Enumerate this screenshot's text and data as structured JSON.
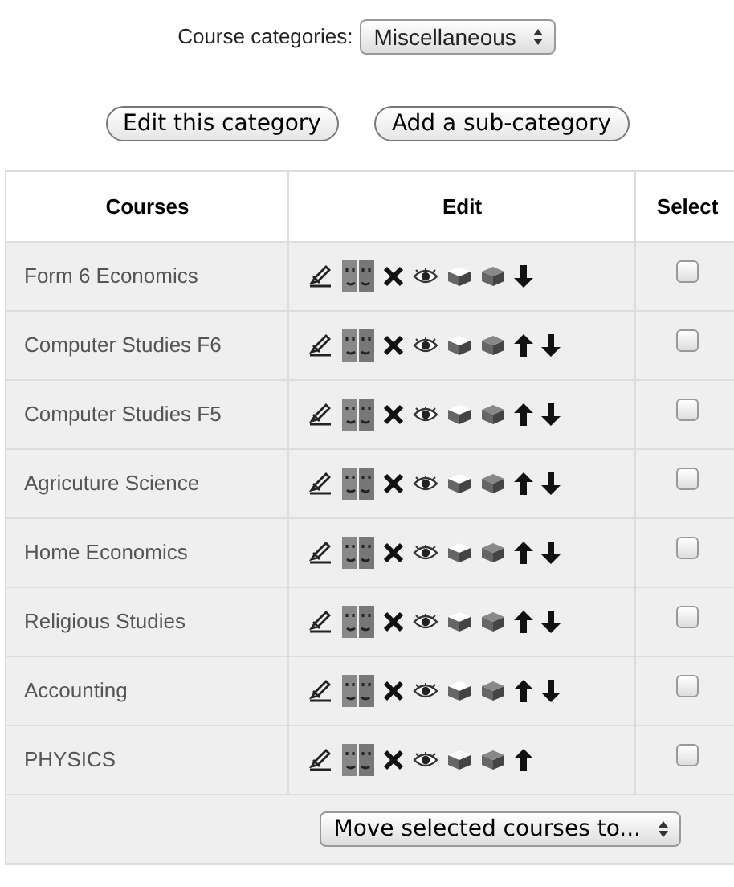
{
  "category_selector": {
    "label": "Course categories:",
    "value": "Miscellaneous"
  },
  "buttons": [
    "Edit this category",
    "Add a sub-category"
  ],
  "table": {
    "columns": [
      "Courses",
      "Edit",
      "Select"
    ],
    "rows": [
      {
        "name": "Form 6 Economics",
        "move_up": false,
        "move_down": true,
        "checked": false
      },
      {
        "name": "Computer Studies F6",
        "move_up": true,
        "move_down": true,
        "checked": false
      },
      {
        "name": "Computer Studies F5",
        "move_up": true,
        "move_down": true,
        "checked": false
      },
      {
        "name": "Agricuture Science",
        "move_up": true,
        "move_down": true,
        "checked": false
      },
      {
        "name": "Home Economics",
        "move_up": true,
        "move_down": true,
        "checked": false
      },
      {
        "name": "Religious Studies",
        "move_up": true,
        "move_down": true,
        "checked": false
      },
      {
        "name": "Accounting",
        "move_up": true,
        "move_down": true,
        "checked": false
      },
      {
        "name": "PHYSICS",
        "move_up": true,
        "move_down": false,
        "checked": false
      }
    ],
    "move_selector": {
      "value": "Move selected courses to..."
    }
  }
}
